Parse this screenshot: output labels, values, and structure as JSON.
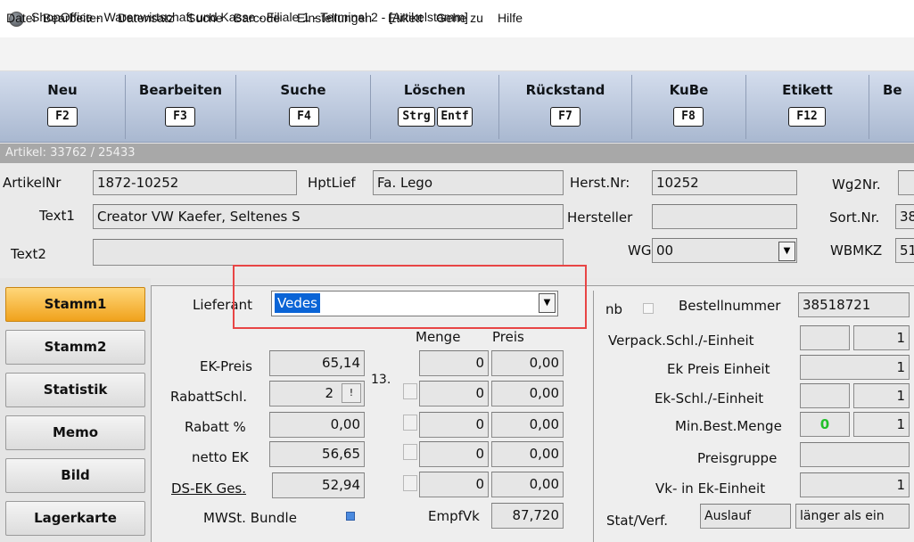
{
  "window": {
    "title": "ShopOffice - Warenwirtschaft und Kasse - Filiale 1 - Terminal 2 - [Artikelstamm]",
    "icon": "app-logo-icon"
  },
  "menu": [
    "Datei",
    "Bearbeiten",
    "Datensatz",
    "Suche",
    "Barcode",
    "Einstellungen",
    "Etikett",
    "Gehe zu",
    "Hilfe"
  ],
  "toolbar": [
    {
      "label": "Neu",
      "key": "F2"
    },
    {
      "label": "Bearbeiten",
      "key": "F3"
    },
    {
      "label": "Suche",
      "key": "F4"
    },
    {
      "label": "Löschen",
      "key1": "Strg",
      "key2": "Entf"
    },
    {
      "label": "Rückstand",
      "key": "F7"
    },
    {
      "label": "KuBe",
      "key": "F8"
    },
    {
      "label": "Etikett",
      "key": "F12"
    },
    {
      "label": "Be"
    }
  ],
  "status": {
    "text": "Artikel: 33762 / 25433"
  },
  "header": {
    "artikelnr_label": "ArtikelNr",
    "artikelnr": "1872-10252",
    "hptlief_label": "HptLief",
    "hptlief": "Fa. Lego",
    "herstnr_label": "Herst.Nr:",
    "herstnr": "10252",
    "wg2nr_label": "Wg2Nr.",
    "wg2nr": "",
    "text1_label": "Text1",
    "text1": "Creator VW Kaefer, Seltenes S",
    "hersteller_label": "Hersteller",
    "hersteller": "",
    "sortnr_label": "Sort.Nr.",
    "sortnr": "38",
    "text2_label": "Text2",
    "text2": "",
    "wg_label": "WG",
    "wg": "00",
    "wbmkz_label": "WBMKZ",
    "wbmkz": "51"
  },
  "nav": [
    {
      "label": "Stamm1",
      "active": true
    },
    {
      "label": "Stamm2",
      "active": false
    },
    {
      "label": "Statistik",
      "active": false
    },
    {
      "label": "Memo",
      "active": false
    },
    {
      "label": "Bild",
      "active": false
    },
    {
      "label": "Lagerkarte",
      "active": false
    }
  ],
  "stamm1": {
    "lieferant_label": "Lieferant",
    "lieferant": "Vedes",
    "menge_header": "Menge",
    "preis_header": "Preis",
    "ek_preis_label": "EK-Preis",
    "ek_preis": "65,14",
    "rabattschl_label": "RabattSchl.",
    "rabattschl": "2",
    "rabattschl_btn": "!",
    "thirteen": "13.",
    "rabatt_label": "Rabatt %",
    "rabatt": "0,00",
    "netto_ek_label": "netto EK",
    "netto_ek": "56,65",
    "ds_ek_label": "DS-EK Ges.",
    "ds_ek": "52,94",
    "mwst_label": "MWSt. Bundle",
    "empfvk_label": "EmpfVk",
    "empfvk": "87,720",
    "staffel": [
      {
        "menge": "0",
        "preis": "0,00"
      },
      {
        "menge": "0",
        "preis": "0,00"
      },
      {
        "menge": "0",
        "preis": "0,00"
      },
      {
        "menge": "0",
        "preis": "0,00"
      },
      {
        "menge": "0",
        "preis": "0,00"
      }
    ]
  },
  "right": {
    "nb_label": "nb",
    "bestellnummer_label": "Bestellnummer",
    "bestellnummer": "38518721",
    "verpack_label": "Verpack.Schl./-Einheit",
    "verpack_val": "1",
    "ekpreis_einheit_label": "Ek Preis Einheit",
    "ekpreis_einheit": "1",
    "ekschl_label": "Ek-Schl./-Einheit",
    "ekschl_val": "1",
    "minbest_label": "Min.Best.Menge",
    "minbest_green": "0",
    "minbest_val": "1",
    "preisgruppe_label": "Preisgruppe",
    "preisgruppe": "",
    "vk_ek_label": "Vk- in Ek-Einheit",
    "vk_ek": "1",
    "statverf_label": "Stat/Verf.",
    "statverf": "Auslauf",
    "statverf2": "länger als ein"
  },
  "colors": {
    "accent_orange": "#f0a21c",
    "highlight_red": "#e84545",
    "selection_blue": "#0a64d6",
    "green_value": "#22c02a"
  }
}
